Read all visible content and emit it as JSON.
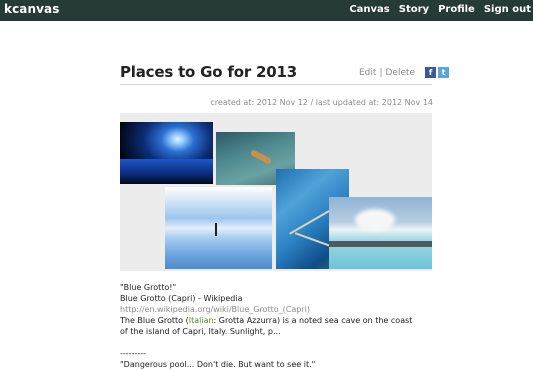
{
  "header": {
    "brand": "kcanvas",
    "nav": [
      "Canvas",
      "Story",
      "Profile",
      "Sign out"
    ]
  },
  "post": {
    "title": "Places to Go for 2013",
    "edit_label": "Edit",
    "separator": "|",
    "delete_label": "Delete",
    "social": {
      "facebook_icon": "f",
      "twitter_icon": "t"
    },
    "dates": "created at: 2012 Nov 12  /  last updated at: 2012 Nov 14"
  },
  "collage": {
    "background": "#ececec",
    "photos": [
      "blue-grotto-photo",
      "swimmer-photo",
      "salt-flat-reflection-photo",
      "dangerous-pool-photo",
      "hot-spring-photo"
    ]
  },
  "text": {
    "quote1": "\"Blue Grotto!\"",
    "source1": "Blue Grotto (Capri) - Wikipedia",
    "url1": "http://en.wikipedia.org/wiki/Blue_Grotto_(Capri)",
    "desc_pre": "The Blue Grotto (",
    "desc_link": "Italian",
    "desc_post": ": Grotta Azzurra) is a noted sea cave on the coast of the island of Capri, Italy. Sunlight, p...",
    "divider": "---------",
    "quote2": "\"Dangerous pool... Don't die. But want to see it.\""
  },
  "colors": {
    "topbar": "#263a38",
    "link_green": "#5a8a3a",
    "facebook": "#3b5998",
    "twitter": "#5aa4d8"
  }
}
